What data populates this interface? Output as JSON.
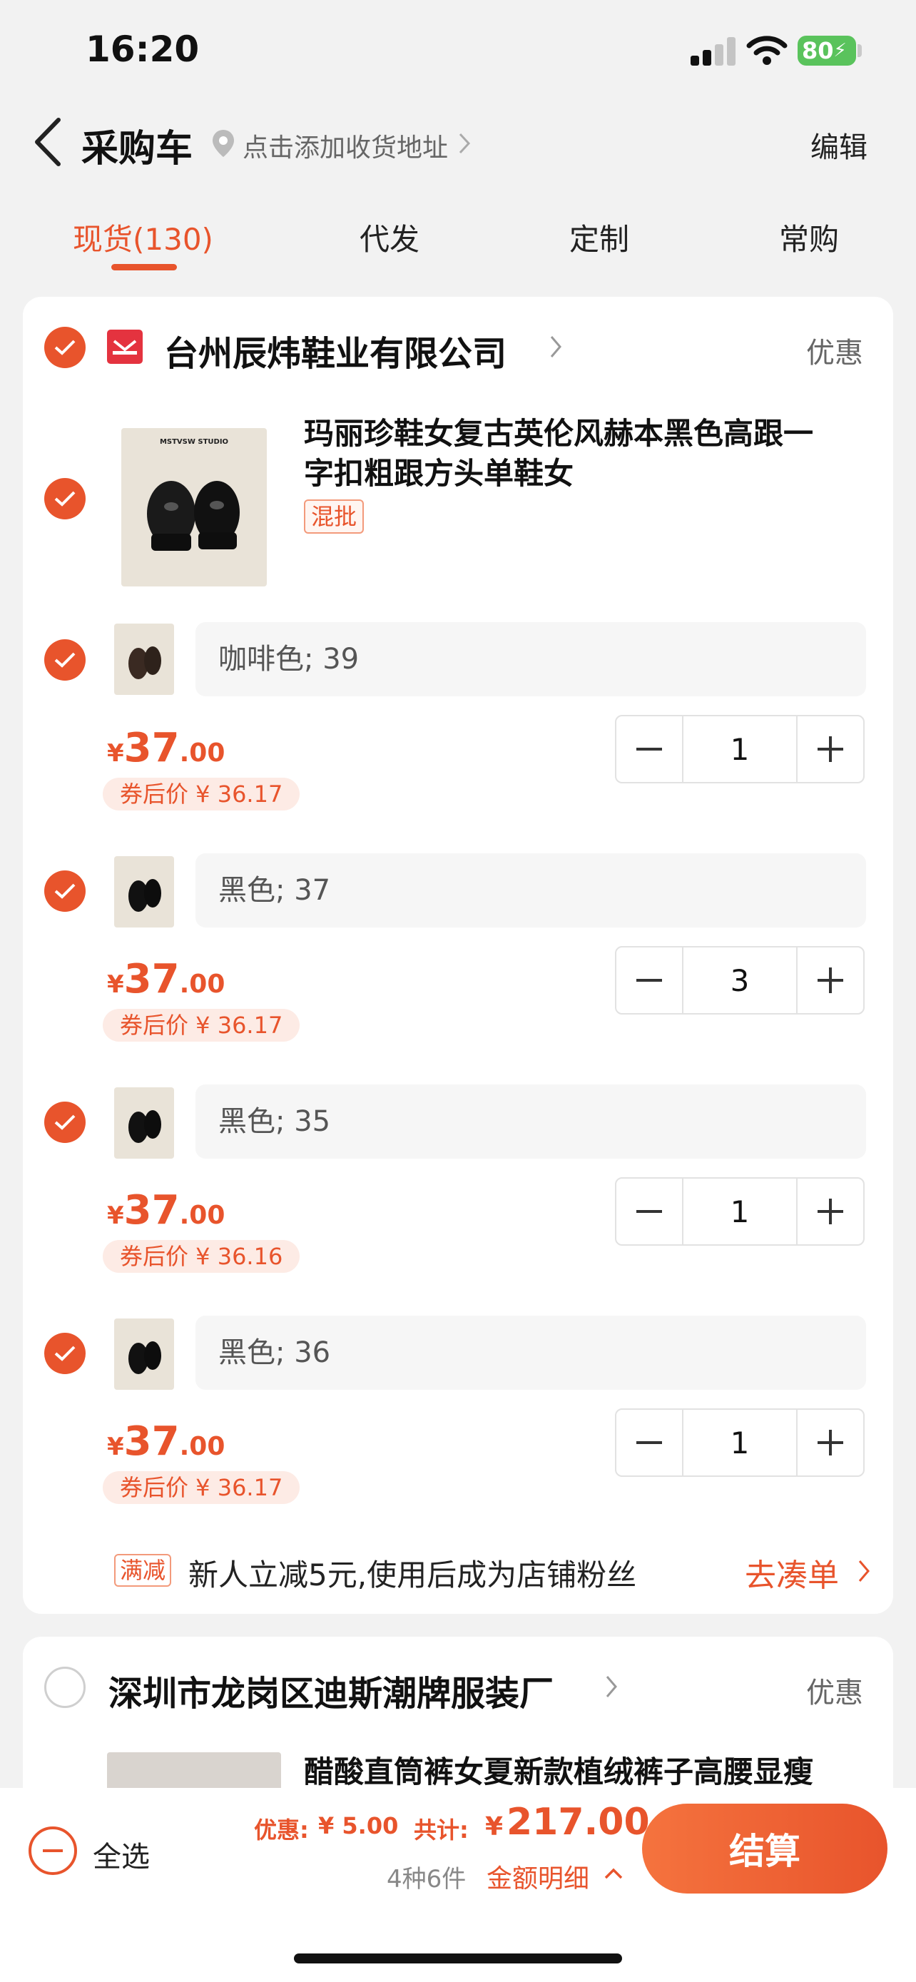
{
  "status": {
    "time": "16:20",
    "battery": "80"
  },
  "nav": {
    "title": "采购车",
    "address": "点击添加收货地址",
    "edit": "编辑"
  },
  "tabs": [
    "现货(130)",
    "代发",
    "定制",
    "常购"
  ],
  "shop1": {
    "name": "台州辰炜鞋业有限公司",
    "promo_link": "优惠",
    "product": {
      "title_line1": "玛丽珍鞋女复古英伦风赫本黑色高跟一",
      "title_line2": "字扣粗跟方头单鞋女",
      "tag": "混批",
      "image_brand": "MSTVSW STUDIO"
    },
    "skus": [
      {
        "spec": "咖啡色; 39",
        "currency": "¥",
        "price_int": "37",
        "price_dec": ".00",
        "coupon": "券后价 ¥ 36.17",
        "qty": "1"
      },
      {
        "spec": "黑色; 37",
        "currency": "¥",
        "price_int": "37",
        "price_dec": ".00",
        "coupon": "券后价 ¥ 36.17",
        "qty": "3"
      },
      {
        "spec": "黑色; 35",
        "currency": "¥",
        "price_int": "37",
        "price_dec": ".00",
        "coupon": "券后价 ¥ 36.16",
        "qty": "1"
      },
      {
        "spec": "黑色; 36",
        "currency": "¥",
        "price_int": "37",
        "price_dec": ".00",
        "coupon": "券后价 ¥ 36.17",
        "qty": "1"
      }
    ],
    "promo": {
      "tag": "满减",
      "text": "新人立减5元,使用后成为店铺粉丝",
      "link": "去凑单"
    }
  },
  "shop2": {
    "name": "深圳市龙岗区迪斯潮牌服装厂",
    "promo_link": "优惠",
    "product_title": "醋酸直筒裤女夏新款植绒裤子高腰显瘦"
  },
  "bottom": {
    "select_all": "全选",
    "discount_label": "优惠:",
    "discount_value": "¥ 5.00",
    "total_label": "共计:",
    "total_currency": "¥",
    "total_value": "217.00",
    "count": "4种6件",
    "detail": "金额明细",
    "pay": "结算"
  },
  "colors": {
    "accent": "#e8542c",
    "shop_icon": "#e4333f",
    "battery": "#5ac35c"
  }
}
